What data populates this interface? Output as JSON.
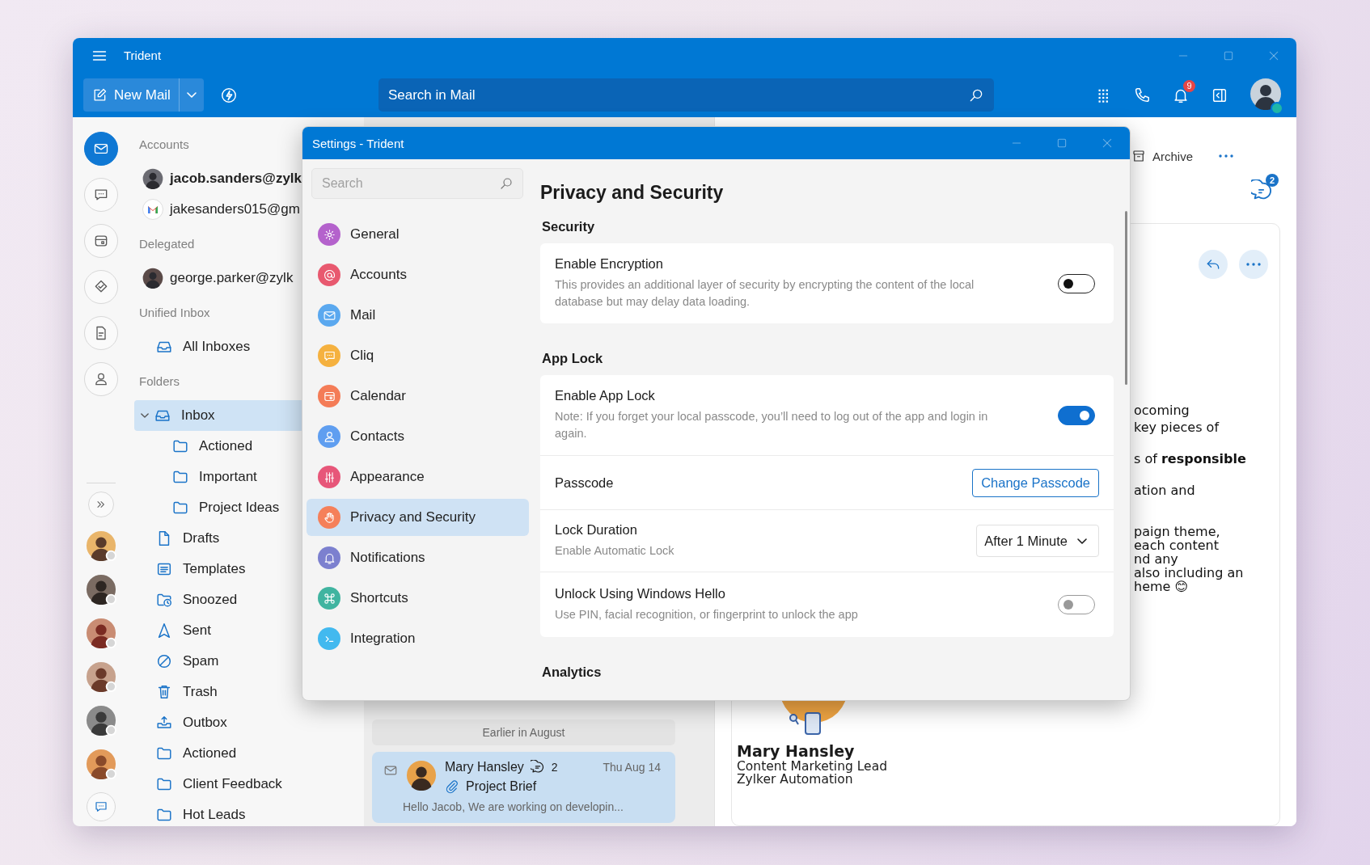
{
  "window": {
    "title": "Trident"
  },
  "toolbar": {
    "new_mail": "New Mail",
    "search": {
      "placeholder": "Search in Mail"
    },
    "notification_count": "9"
  },
  "rail": [
    {
      "selected": true
    },
    {
      "selected": false
    },
    {
      "selected": false
    },
    {
      "selected": false
    },
    {
      "selected": false
    },
    {
      "selected": false
    }
  ],
  "folder_pane": {
    "sections": [
      {
        "title": "Accounts",
        "items": [
          {
            "kind": "account",
            "label": "jacob.sanders@zylk",
            "selected": true
          },
          {
            "kind": "gmail",
            "label": "jakesanders015@gm",
            "selected": false
          }
        ]
      },
      {
        "title": "Delegated",
        "items": [
          {
            "kind": "account",
            "label": "george.parker@zylk",
            "selected": false
          }
        ]
      },
      {
        "title": "Unified Inbox",
        "items": [
          {
            "kind": "inbox",
            "label": "All Inboxes",
            "selected": false
          }
        ]
      },
      {
        "title": "Folders",
        "items": [
          {
            "kind": "inbox",
            "label": "Inbox",
            "selected": true,
            "expanded": true,
            "children": [
              {
                "kind": "folder",
                "label": "Actioned",
                "selected": false
              },
              {
                "kind": "folder",
                "label": "Important",
                "selected": false
              },
              {
                "kind": "folder",
                "label": "Project Ideas",
                "selected": false
              }
            ]
          },
          {
            "kind": "drafts",
            "label": "Drafts",
            "selected": false
          },
          {
            "kind": "templates",
            "label": "Templates",
            "selected": false
          },
          {
            "kind": "snoozed",
            "label": "Snoozed",
            "selected": false
          },
          {
            "kind": "sent",
            "label": "Sent",
            "selected": false
          },
          {
            "kind": "spam",
            "label": "Spam",
            "selected": false
          },
          {
            "kind": "trash",
            "label": "Trash",
            "selected": false
          },
          {
            "kind": "outbox",
            "label": "Outbox",
            "selected": false
          },
          {
            "kind": "folder",
            "label": "Actioned",
            "selected": false
          },
          {
            "kind": "folder",
            "label": "Client Feedback",
            "selected": false
          },
          {
            "kind": "folder",
            "label": "Hot Leads",
            "selected": false
          }
        ]
      }
    ]
  },
  "mail_list": {
    "group": "Earlier in August",
    "messages": [
      {
        "sender": "Mary Hansley",
        "thread_count": "2",
        "date": "Thu Aug 14",
        "subject": "Project Brief",
        "preview": "Hello Jacob, We are working on developin...",
        "attachment": true,
        "selected": true
      }
    ]
  },
  "reading_pane": {
    "archive": "Archive",
    "chat_count": "2",
    "paragraphs": [
      {
        "lines": [
          "ocoming",
          "key pieces of"
        ]
      },
      {
        "lines": [
          "s of **responsible**"
        ]
      },
      {
        "lines": [
          "ation and"
        ]
      },
      {
        "lines": [
          "paign theme,",
          "each content",
          "nd any",
          "also including an",
          "heme 😊"
        ]
      }
    ],
    "signature": {
      "name": "Mary Hansley",
      "title": "Content Marketing Lead",
      "company": "Zylker Automation"
    }
  },
  "settings": {
    "title": "Settings - Trident",
    "search": {
      "placeholder": "Search"
    },
    "nav": [
      {
        "label": "General",
        "color": "#b462cc",
        "selected": false
      },
      {
        "label": "Accounts",
        "color": "#e8596f",
        "selected": false
      },
      {
        "label": "Mail",
        "color": "#5aa8ef",
        "selected": false
      },
      {
        "label": "Cliq",
        "color": "#f5b13f",
        "selected": false
      },
      {
        "label": "Calendar",
        "color": "#f47c57",
        "selected": false
      },
      {
        "label": "Contacts",
        "color": "#5f9ef0",
        "selected": false
      },
      {
        "label": "Appearance",
        "color": "#e75679",
        "selected": false
      },
      {
        "label": "Privacy and Security",
        "color": "#f5805a",
        "selected": true
      },
      {
        "label": "Notifications",
        "color": "#7c80cf",
        "selected": false
      },
      {
        "label": "Shortcuts",
        "color": "#40b4a0",
        "selected": false
      },
      {
        "label": "Integration",
        "color": "#42b9ef",
        "selected": false
      }
    ],
    "heading": "Privacy and Security",
    "sections": [
      {
        "title": "Security",
        "rows": [
          {
            "kind": "toggle",
            "label": "Enable Encryption",
            "description": "This provides an additional layer of security by encrypting the content of the local database but may delay data loading.",
            "on": false,
            "disabled": false
          }
        ]
      },
      {
        "title": "App Lock",
        "rows": [
          {
            "kind": "toggle",
            "label": "Enable App Lock",
            "description": "Note: If you forget your local passcode, you’ll need to log out of the app and login in again.",
            "on": true,
            "disabled": false
          },
          {
            "kind": "button",
            "label": "Passcode",
            "button": "Change Passcode"
          },
          {
            "kind": "dropdown",
            "label": "Lock Duration",
            "description": "Enable Automatic Lock",
            "value": "After 1 Minute"
          },
          {
            "kind": "toggle",
            "label": "Unlock Using Windows Hello",
            "description": "Use PIN, facial recognition, or fingerprint to unlock the app",
            "on": false,
            "disabled": true
          }
        ]
      },
      {
        "title": "Analytics"
      }
    ]
  }
}
